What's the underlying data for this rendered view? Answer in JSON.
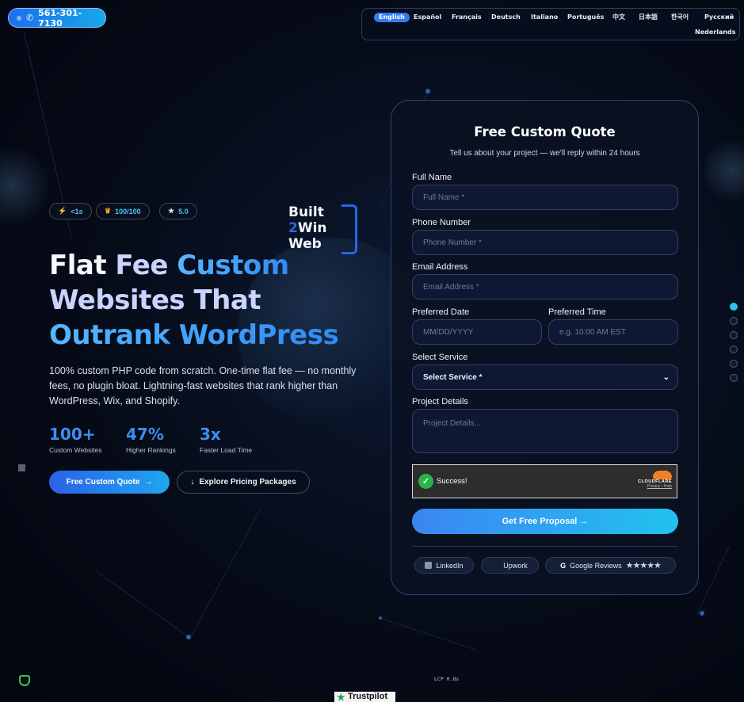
{
  "phone": {
    "number": "561-301-7130"
  },
  "languages": [
    {
      "label": "English",
      "active": true
    },
    {
      "label": "Español"
    },
    {
      "label": "Français"
    },
    {
      "label": "Deutsch"
    },
    {
      "label": "Italiano"
    },
    {
      "label": "Português"
    },
    {
      "label": "中文"
    },
    {
      "label": "日本語"
    },
    {
      "label": "한국어"
    },
    {
      "label": "Русский"
    },
    {
      "label": "Nederlands"
    }
  ],
  "badges": [
    {
      "icon": "lightning-icon",
      "label": "<1s"
    },
    {
      "icon": "trophy-icon",
      "label": "100/100"
    },
    {
      "icon": "star-icon",
      "label": "5.0"
    }
  ],
  "logo": {
    "line1": "Built",
    "line2_num": "2",
    "line2_rest": "Win",
    "line3": "Web"
  },
  "hero": {
    "title_part1": "Flat ",
    "title_part2": "Fee ",
    "title_part3": "Custom",
    "title_line2": "Websites That",
    "title_line3": "Outrank WordPress",
    "description": "100% custom PHP code from scratch. One-time flat fee — no monthly fees, no plugin bloat. Lightning-fast websites that rank higher than WordPress, Wix, and Shopify."
  },
  "stats": [
    {
      "value": "100+",
      "label": "Custom Websites"
    },
    {
      "value": "47%",
      "label": "Higher Rankings"
    },
    {
      "value": "3x",
      "label": "Faster Load Time"
    }
  ],
  "cta": {
    "primary": "Free Custom Quote",
    "primary_arrow": "→",
    "secondary_icon": "↓",
    "secondary": "Explore Pricing Packages"
  },
  "form": {
    "title": "Free Custom Quote",
    "subtitle": "Tell us about your project — we'll reply within 24 hours",
    "full_name_label": "Full Name",
    "full_name_placeholder": "Full Name *",
    "phone_label": "Phone Number",
    "phone_placeholder": "Phone Number *",
    "email_label": "Email Address",
    "email_placeholder": "Email Address *",
    "date_label": "Preferred Date",
    "date_placeholder": "MM/DD/YYYY",
    "time_label": "Preferred Time",
    "time_placeholder": "e.g. 10:00 AM EST",
    "service_label": "Select Service",
    "service_value": "Select Service *",
    "details_label": "Project Details",
    "details_placeholder": "Project Details...",
    "captcha_status": "Success!",
    "captcha_brand": "CLOUDFLARE",
    "captcha_links": "Privacy • Help",
    "submit": "Get Free Proposal →"
  },
  "social": [
    {
      "icon": "linkedin-icon",
      "label": "LinkedIn"
    },
    {
      "icon": "upwork-icon",
      "label": "Upwork"
    },
    {
      "icon": "google-icon",
      "label": "Google Reviews",
      "stars": "★★★★★"
    }
  ],
  "footer": {
    "lcp": "LCP 0.8s",
    "trustpilot": "Trustpilot"
  },
  "colors": {
    "accent": "#2f7df0",
    "cyan": "#22c2ee",
    "background": "#060b18"
  }
}
